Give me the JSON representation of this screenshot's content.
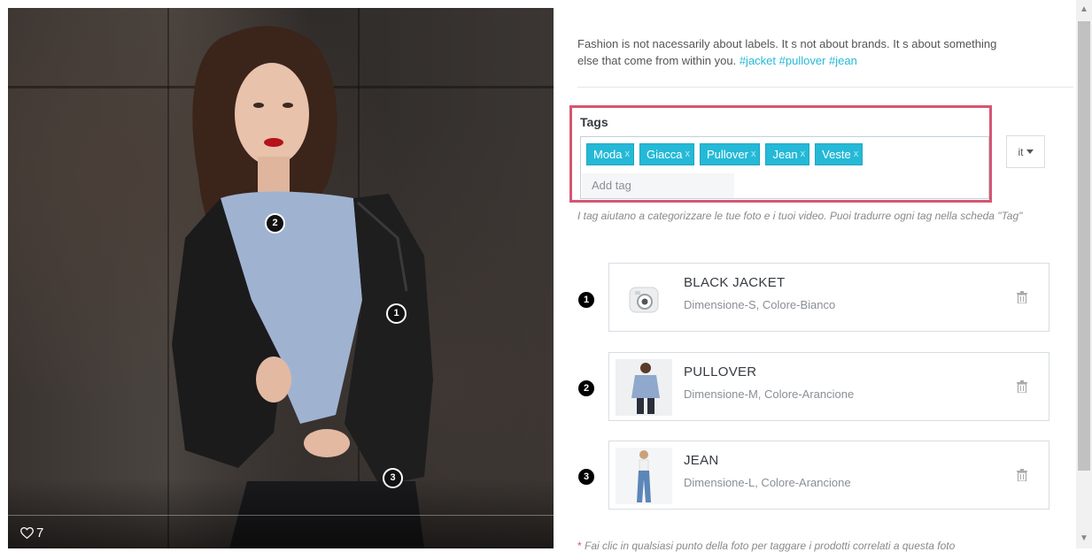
{
  "post": {
    "likes": "7",
    "markers": [
      "1",
      "2",
      "3"
    ]
  },
  "details": {
    "description": "Fashion is not nacessarily about labels. It s not about brands. It s about something else that come from within you.",
    "hashtags": "#jacket #pullover #jean"
  },
  "tags": {
    "label": "Tags",
    "chips": [
      "Moda",
      "Giacca",
      "Pullover",
      "Jean",
      "Veste"
    ],
    "remove_symbol": "x",
    "add_placeholder": "Add tag",
    "language": "it",
    "help": "I tag aiutano a categorizzare le tue foto e i tuoi video. Puoi tradurre ogni tag nella scheda \"Tag\""
  },
  "products": [
    {
      "number": "1",
      "name": "BLACK JACKET",
      "variant": "Dimensione-S, Colore-Bianco"
    },
    {
      "number": "2",
      "name": "PULLOVER",
      "variant": "Dimensione-M, Colore-Arancione"
    },
    {
      "number": "3",
      "name": "JEAN",
      "variant": "Dimensione-L, Colore-Arancione"
    }
  ],
  "footnote": {
    "star": "*",
    "text": "Fai clic in qualsiasi punto della foto per taggare i prodotti correlati a questa foto"
  },
  "colors": {
    "accent": "#25b9d7",
    "highlight_border": "#d55673"
  }
}
